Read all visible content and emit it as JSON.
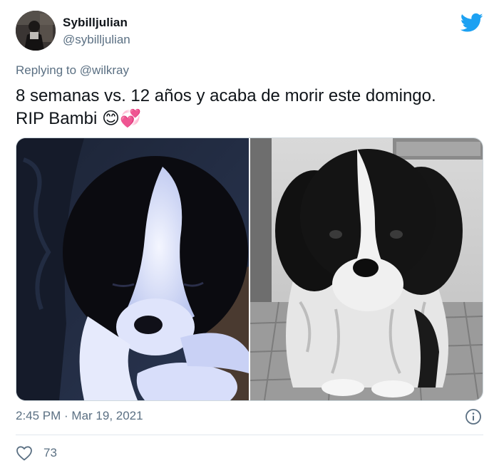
{
  "author": {
    "display_name": "Sybilljulian",
    "handle": "@sybilljulian"
  },
  "brand": {
    "icon": "twitter-bird-icon",
    "color": "#1da1f2"
  },
  "reply": {
    "label": "Replying to",
    "mention": "@wilkray"
  },
  "tweet": {
    "line1": "8 semanas vs. 12 años y acaba de morir este domingo.",
    "line2": "RIP Bambi 😊💞"
  },
  "media": {
    "left_image": "puppy-photo",
    "right_image": "old-dog-photo"
  },
  "footer": {
    "timestamp": "2:45 PM · Mar 19, 2021",
    "likes": "73",
    "info_icon": "info-icon",
    "like_icon": "heart-icon"
  }
}
